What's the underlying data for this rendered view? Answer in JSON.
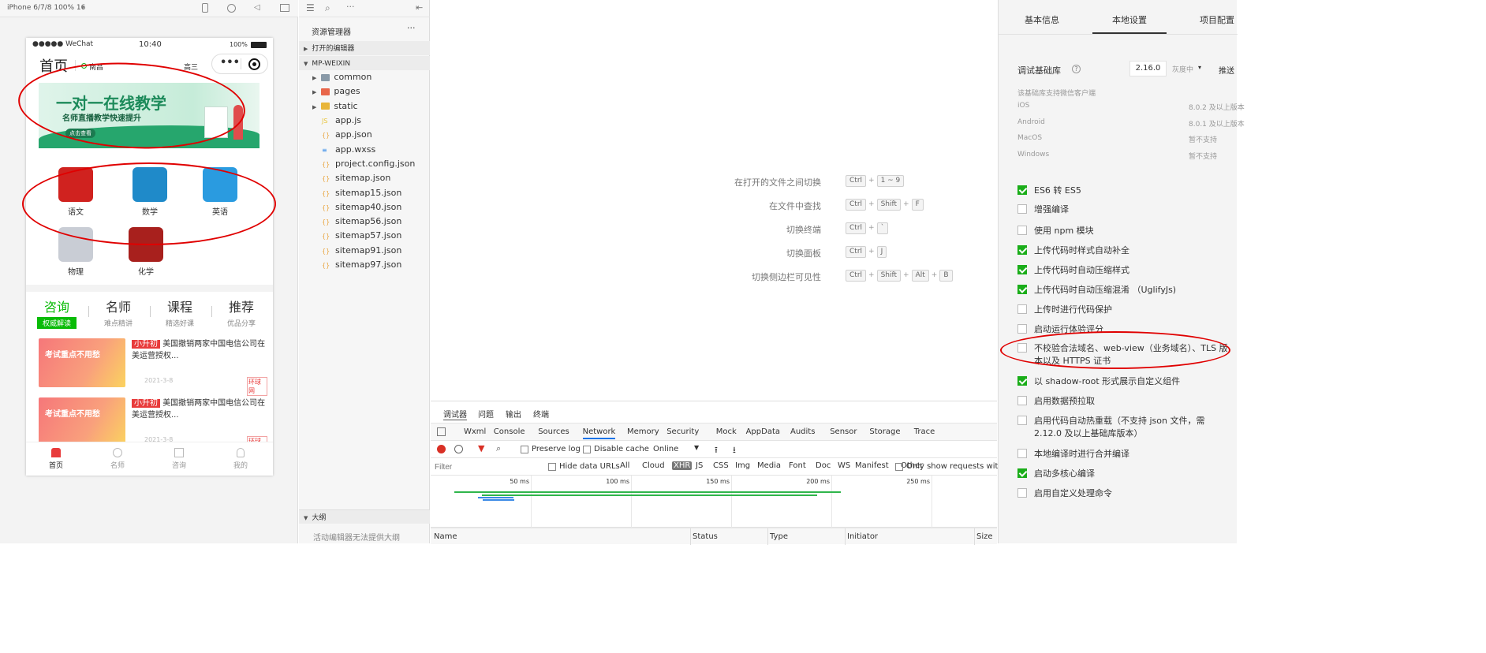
{
  "simulator": {
    "device_label": "iPhone 6/7/8 100% 16",
    "status": {
      "carrier": "●●●●● WeChat",
      "time": "10:40",
      "battery": "100%"
    },
    "nav": {
      "title": "首页",
      "location": "南昌",
      "grade": "高三"
    },
    "banner": {
      "title": "一对一在线教学",
      "subtitle": "名师直播教学快速提升",
      "button": "点击查看"
    },
    "categories": [
      {
        "label": "语文",
        "color": "#d0221f"
      },
      {
        "label": "数学",
        "color": "#1f8ac9"
      },
      {
        "label": "英语",
        "color": "#2a9be0"
      },
      {
        "label": "物理",
        "color": "#c9cdd5"
      },
      {
        "label": "化学",
        "color": "#a8201d"
      }
    ],
    "tabs": [
      {
        "title": "咨询",
        "sub": "权威解读",
        "active": true
      },
      {
        "title": "名师",
        "sub": "难点精讲",
        "active": false
      },
      {
        "title": "课程",
        "sub": "精选好课",
        "active": false
      },
      {
        "title": "推荐",
        "sub": "优品分享",
        "active": false
      }
    ],
    "news": [
      {
        "img_text": "考试重点不用愁",
        "tag": "小升初",
        "title": "美国撤销两家中国电信公司在美运营授权...",
        "date": "2021-3-8",
        "source": "环球网"
      },
      {
        "img_text": "考试重点不用愁",
        "tag": "小升初",
        "title": "美国撤销两家中国电信公司在美运营授权...",
        "date": "2021-3-8",
        "source": "环球网"
      }
    ],
    "bottom_tabs": [
      {
        "label": "首页",
        "active": true
      },
      {
        "label": "名师",
        "active": false
      },
      {
        "label": "咨询",
        "active": false
      },
      {
        "label": "我的",
        "active": false
      }
    ]
  },
  "explorer": {
    "title": "资源管理器",
    "more": "···",
    "open_editors": "打开的编辑器",
    "project": "MP-WEIXIN",
    "folders": [
      {
        "name": "common",
        "color": "#8a9aa8"
      },
      {
        "name": "pages",
        "color": "#e8664a"
      },
      {
        "name": "static",
        "color": "#e8b53a"
      }
    ],
    "files": [
      {
        "name": "app.js",
        "icon": "js-icon",
        "color": "#e8c43a"
      },
      {
        "name": "app.json",
        "icon": "json-icon",
        "color": "#e8a33a"
      },
      {
        "name": "app.wxss",
        "icon": "css-icon",
        "color": "#3a8ee8"
      },
      {
        "name": "project.config.json",
        "icon": "json-icon",
        "color": "#e8a33a"
      },
      {
        "name": "sitemap.json",
        "icon": "json-icon",
        "color": "#e8a33a"
      },
      {
        "name": "sitemap15.json",
        "icon": "json-icon",
        "color": "#e8a33a"
      },
      {
        "name": "sitemap40.json",
        "icon": "json-icon",
        "color": "#e8a33a"
      },
      {
        "name": "sitemap56.json",
        "icon": "json-icon",
        "color": "#e8a33a"
      },
      {
        "name": "sitemap57.json",
        "icon": "json-icon",
        "color": "#e8a33a"
      },
      {
        "name": "sitemap91.json",
        "icon": "json-icon",
        "color": "#e8a33a"
      },
      {
        "name": "sitemap97.json",
        "icon": "json-icon",
        "color": "#e8a33a"
      }
    ],
    "outline_title": "大纲",
    "outline_msg": "活动编辑器无法提供大纲"
  },
  "shortcuts": [
    {
      "label": "在打开的文件之间切换",
      "keys": [
        "Ctrl",
        "1 ~ 9"
      ]
    },
    {
      "label": "在文件中查找",
      "keys": [
        "Ctrl",
        "Shift",
        "F"
      ]
    },
    {
      "label": "切换终端",
      "keys": [
        "Ctrl",
        "`"
      ]
    },
    {
      "label": "切换面板",
      "keys": [
        "Ctrl",
        "J"
      ]
    },
    {
      "label": "切换侧边栏可见性",
      "keys": [
        "Ctrl",
        "Shift",
        "Alt",
        "B"
      ]
    }
  ],
  "devtools": {
    "top_tabs": [
      "调试器",
      "问题",
      "输出",
      "终端"
    ],
    "panel_tabs": [
      "Wxml",
      "Console",
      "Sources",
      "Network",
      "Memory",
      "Security",
      "Mock",
      "AppData",
      "Audits",
      "Sensor",
      "Storage",
      "Trace"
    ],
    "active_panel": "Network",
    "preserve_log": "Preserve log",
    "disable_cache": "Disable cache",
    "online": "Online",
    "filter_placeholder": "Filter",
    "hide_data_urls": "Hide data URLs",
    "filter_types": [
      "All",
      "Cloud",
      "XHR",
      "JS",
      "CSS",
      "Img",
      "Media",
      "Font",
      "Doc",
      "WS",
      "Manifest",
      "Other"
    ],
    "active_filter": "XHR",
    "only_show": "Only show requests with S",
    "timeline_ticks": [
      "50 ms",
      "100 ms",
      "150 ms",
      "200 ms",
      "250 ms"
    ],
    "columns": [
      "Name",
      "Status",
      "Type",
      "Initiator",
      "Size"
    ]
  },
  "settings": {
    "tabs": [
      "基本信息",
      "本地设置",
      "项目配置"
    ],
    "active_tab": "本地设置",
    "base_lib_label": "调试基础库",
    "base_lib_version": "2.16.0",
    "gray": "灰度中",
    "push": "推送",
    "support_note": "该基础库支持微信客户端",
    "platforms": [
      {
        "name": "iOS",
        "value": "8.0.2 及以上版本"
      },
      {
        "name": "Android",
        "value": "8.0.1 及以上版本"
      },
      {
        "name": "MacOS",
        "value": "暂不支持"
      },
      {
        "name": "Windows",
        "value": "暂不支持"
      }
    ],
    "options": [
      {
        "label": "ES6 转 ES5",
        "checked": true
      },
      {
        "label": "增强编译",
        "checked": false
      },
      {
        "label": "使用 npm 模块",
        "checked": false
      },
      {
        "label": "上传代码时样式自动补全",
        "checked": true
      },
      {
        "label": "上传代码时自动压缩样式",
        "checked": true
      },
      {
        "label": "上传代码时自动压缩混淆 （UglifyJs)",
        "checked": true
      },
      {
        "label": "上传时进行代码保护",
        "checked": false
      },
      {
        "label": "启动运行体验评分",
        "checked": false
      },
      {
        "label": "不校验合法域名、web-view（业务域名）、TLS 版本以及 HTTPS 证书",
        "checked": false
      },
      {
        "label": "以 shadow-root 形式展示自定义组件",
        "checked": true
      },
      {
        "label": "启用数据预拉取",
        "checked": false
      },
      {
        "label": "启用代码自动热重载（不支持 json 文件，需 2.12.0 及以上基础库版本）",
        "checked": false
      },
      {
        "label": "本地编译时进行合并编译",
        "checked": false
      },
      {
        "label": "启动多核心编译",
        "checked": true
      },
      {
        "label": "启用自定义处理命令",
        "checked": false
      }
    ]
  },
  "colors": {
    "accent_green": "#1aad19",
    "annotation_red": "#e00000",
    "tab_active": "#09bb07"
  }
}
